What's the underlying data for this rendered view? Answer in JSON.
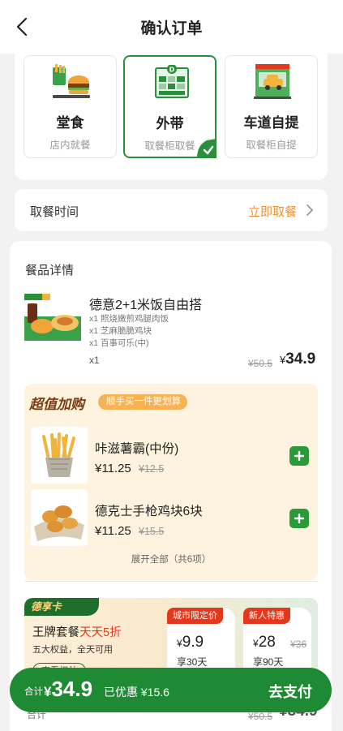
{
  "header": {
    "title": "确认订单",
    "back_icon": "back-arrow-icon"
  },
  "order_types": [
    {
      "name": "堂食",
      "sub": "店内就餐",
      "selected": false,
      "icon": "burger-meal-icon"
    },
    {
      "name": "外带",
      "sub": "取餐柜取餐",
      "selected": true,
      "icon": "pickup-locker-icon"
    },
    {
      "name": "车道自提",
      "sub": "取餐柜自提",
      "selected": false,
      "icon": "drive-thru-icon"
    }
  ],
  "pickup": {
    "label": "取餐时间",
    "value": "立即取餐"
  },
  "meal": {
    "section_title": "餐品详情",
    "name": "德意2+1米饭自由搭",
    "items": [
      "x1 照烧嫩煎鸡腿肉饭",
      "x1 芝麻脆脆鸡块",
      "x1 百事可乐(中)"
    ],
    "qty": "x1",
    "old_price": "¥50.5",
    "currency": "¥",
    "price": "34.9"
  },
  "addon": {
    "title": "超值加购",
    "tag": "顺手买一件更划算",
    "items": [
      {
        "name": "咔滋薯霸(中份)",
        "price": "¥11.25",
        "old_price": "¥12.5"
      },
      {
        "name": "德克士手枪鸡块6块",
        "price": "¥11.25",
        "old_price": "¥15.5"
      }
    ],
    "more": "展开全部（共6项）"
  },
  "membership": {
    "badge": "德享卡",
    "package_prefix": "王牌套餐",
    "package_highlight": "天天5折",
    "features": "五大权益，全天可用",
    "view": "查看权益",
    "offers": [
      {
        "tag": "城市限定价",
        "currency": "¥",
        "price": "9.9",
        "old_price": "",
        "days": "享30天"
      },
      {
        "tag": "新人特惠",
        "currency": "¥",
        "price": "28",
        "old_price": "¥36",
        "days": "享90天"
      }
    ]
  },
  "footer_under": {
    "label": "合计",
    "old_price": "¥50.5",
    "price": "¥34.9"
  },
  "checkout": {
    "label": "合计",
    "currency": "¥",
    "total": "34.9",
    "discount": "已优惠 ¥15.6",
    "pay": "去支付"
  },
  "colors": {
    "brand_green": "#1f8a34",
    "accent_orange": "#f0902a",
    "promo_red": "#e3381c"
  }
}
